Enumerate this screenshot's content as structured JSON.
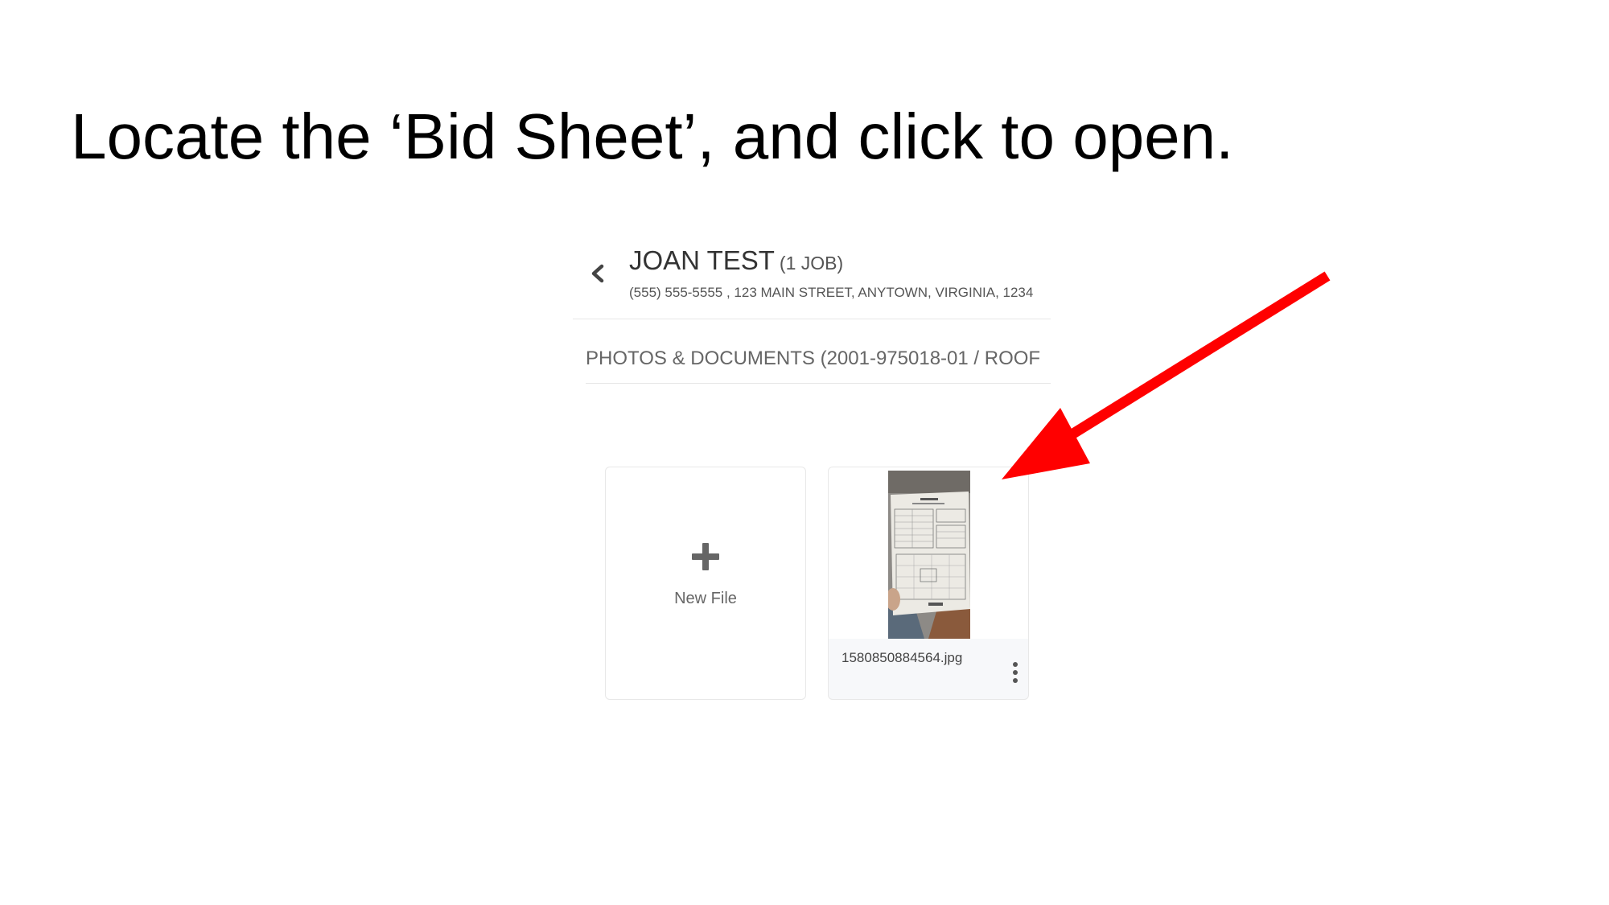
{
  "slide": {
    "instruction": "Locate the ‘Bid Sheet’, and click to open."
  },
  "customer": {
    "name": "JOAN TEST",
    "job_count": "(1 JOB)",
    "contact": "(555) 555-5555 , 123 MAIN STREET, ANYTOWN, VIRGINIA, 1234"
  },
  "section": {
    "title": "PHOTOS & DOCUMENTS (2001-975018-01 / ROOF"
  },
  "files": {
    "new_file_label": "New File",
    "items": [
      {
        "name": "1580850884564.jpg"
      }
    ]
  },
  "icons": {
    "back": "chevron-left-icon",
    "add": "plus-icon",
    "menu": "more-vertical-icon",
    "annotation": "arrow-icon"
  },
  "colors": {
    "annotation_arrow": "#ff0000",
    "text_primary": "#333333",
    "text_secondary": "#666666"
  }
}
